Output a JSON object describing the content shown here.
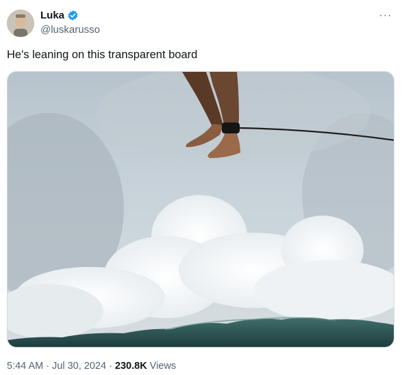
{
  "author": {
    "name": "Luka",
    "handle": "@luskarusso",
    "verified": true,
    "avatar_icon": "profile-photo"
  },
  "tweet": {
    "text": "He's leaning on this transparent board",
    "media_description_icon": "photo-surfer-legs-over-wave"
  },
  "meta": {
    "time": "5:44 AM",
    "separator1": "·",
    "date": "Jul 30, 2024",
    "separator2": "·",
    "views_count": "230.8K",
    "views_label": "Views"
  },
  "colors": {
    "verified": "#1d9bf0",
    "secondary_text": "#536471",
    "primary_text": "#0f1419"
  }
}
